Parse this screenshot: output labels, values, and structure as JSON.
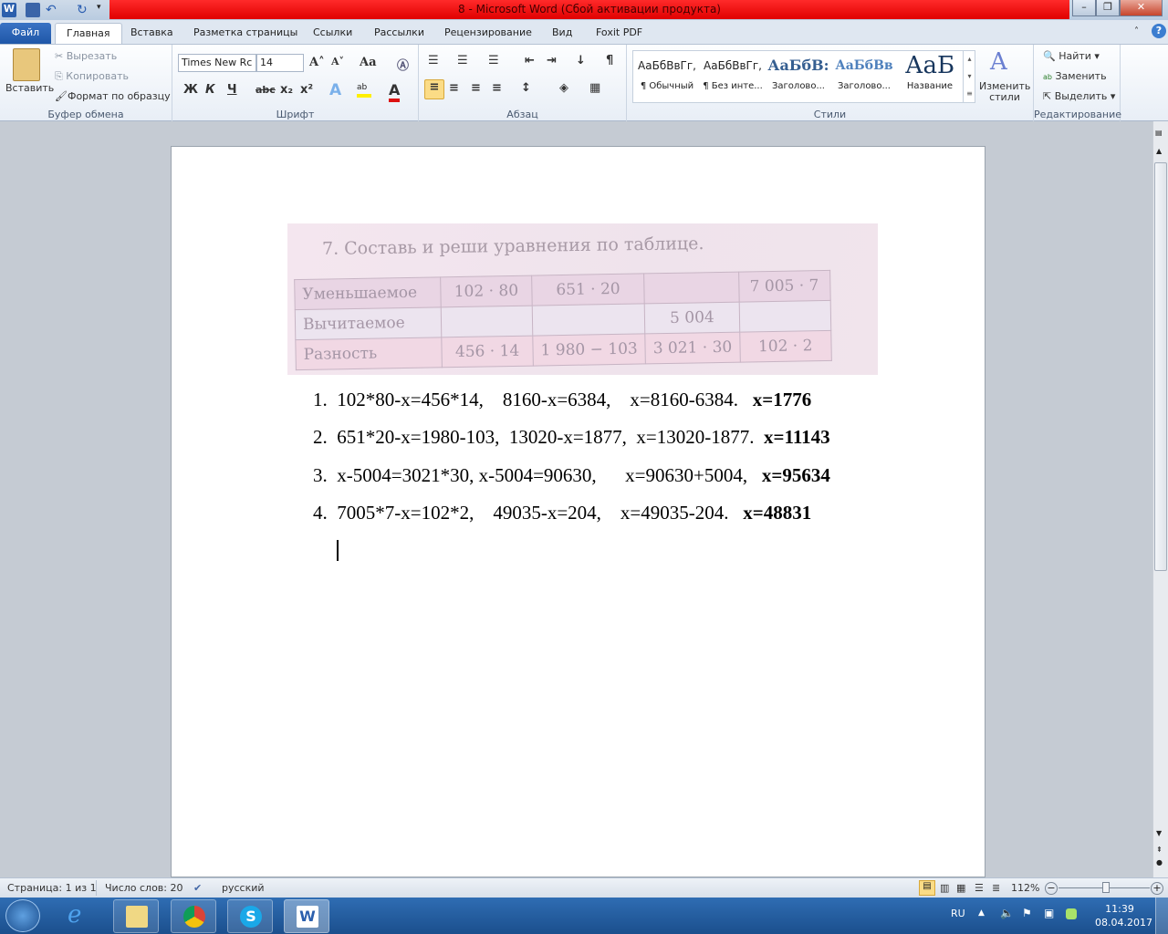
{
  "window": {
    "title": "8  -  Microsoft Word (Сбой активации продукта)"
  },
  "tabs": [
    "Файл",
    "Главная",
    "Вставка",
    "Разметка страницы",
    "Ссылки",
    "Рассылки",
    "Рецензирование",
    "Вид",
    "Foxit PDF"
  ],
  "clipboard": {
    "paste": "Вставить",
    "cut": "Вырезать",
    "copy": "Копировать",
    "format_painter": "Формат по образцу",
    "label": "Буфер обмена"
  },
  "font": {
    "name": "Times New Rc",
    "size": "14",
    "label": "Шрифт",
    "bold": "Ж",
    "italic": "К",
    "underline": "Ч",
    "strike": "abc",
    "sub": "x₂",
    "sup": "x²",
    "grow": "A˄",
    "shrink": "A˅",
    "case": "Aa"
  },
  "paragraph": {
    "label": "Абзац",
    "pilcrow": "¶"
  },
  "styles": {
    "label": "Стили",
    "items": [
      {
        "sample": "АаБбВвГг,",
        "name": "¶ Обычный"
      },
      {
        "sample": "АаБбВвГг,",
        "name": "¶ Без инте..."
      },
      {
        "sample": "АаБбВ:",
        "name": "Заголово..."
      },
      {
        "sample": "АаБбВв",
        "name": "Заголово..."
      },
      {
        "sample": "АаБ",
        "name": "Название"
      }
    ],
    "change": "Изменить стили"
  },
  "editing": {
    "label": "Редактирование",
    "find": "Найти",
    "replace": "Заменить",
    "select": "Выделить"
  },
  "photo": {
    "title": "7. Составь и реши уравнения по таблице.",
    "rows": [
      [
        "Уменьшаемое",
        "102 · 80",
        "651 · 20",
        "",
        "7 005 · 7"
      ],
      [
        "Вычитаемое",
        "",
        "",
        "5 004",
        ""
      ],
      [
        "Разность",
        "456 · 14",
        "1 980 − 103",
        "3 021 · 30",
        "102 · 2"
      ]
    ]
  },
  "list": [
    {
      "num": "1.",
      "text": "102*80-x=456*14,    8160-x=6384,    x=8160-6384.   ",
      "answer": "x=1776"
    },
    {
      "num": "2.",
      "text": "651*20-x=1980-103,  13020-x=1877,  x=13020-1877.  ",
      "answer": "x=11143"
    },
    {
      "num": "3.",
      "text": "x-5004=3021*30, x-5004=90630,      x=90630+5004,   ",
      "answer": "x=95634"
    },
    {
      "num": "4.",
      "text": "7005*7-x=102*2,    49035-x=204,    x=49035-204.   ",
      "answer": "x=48831"
    }
  ],
  "status": {
    "page": "Страница: 1 из 1",
    "words": "Число слов: 20",
    "lang": "русский",
    "zoom": "112%",
    "zoom_value": 112
  },
  "tray": {
    "lang": "RU",
    "time": "11:39",
    "date": "08.04.2017"
  }
}
